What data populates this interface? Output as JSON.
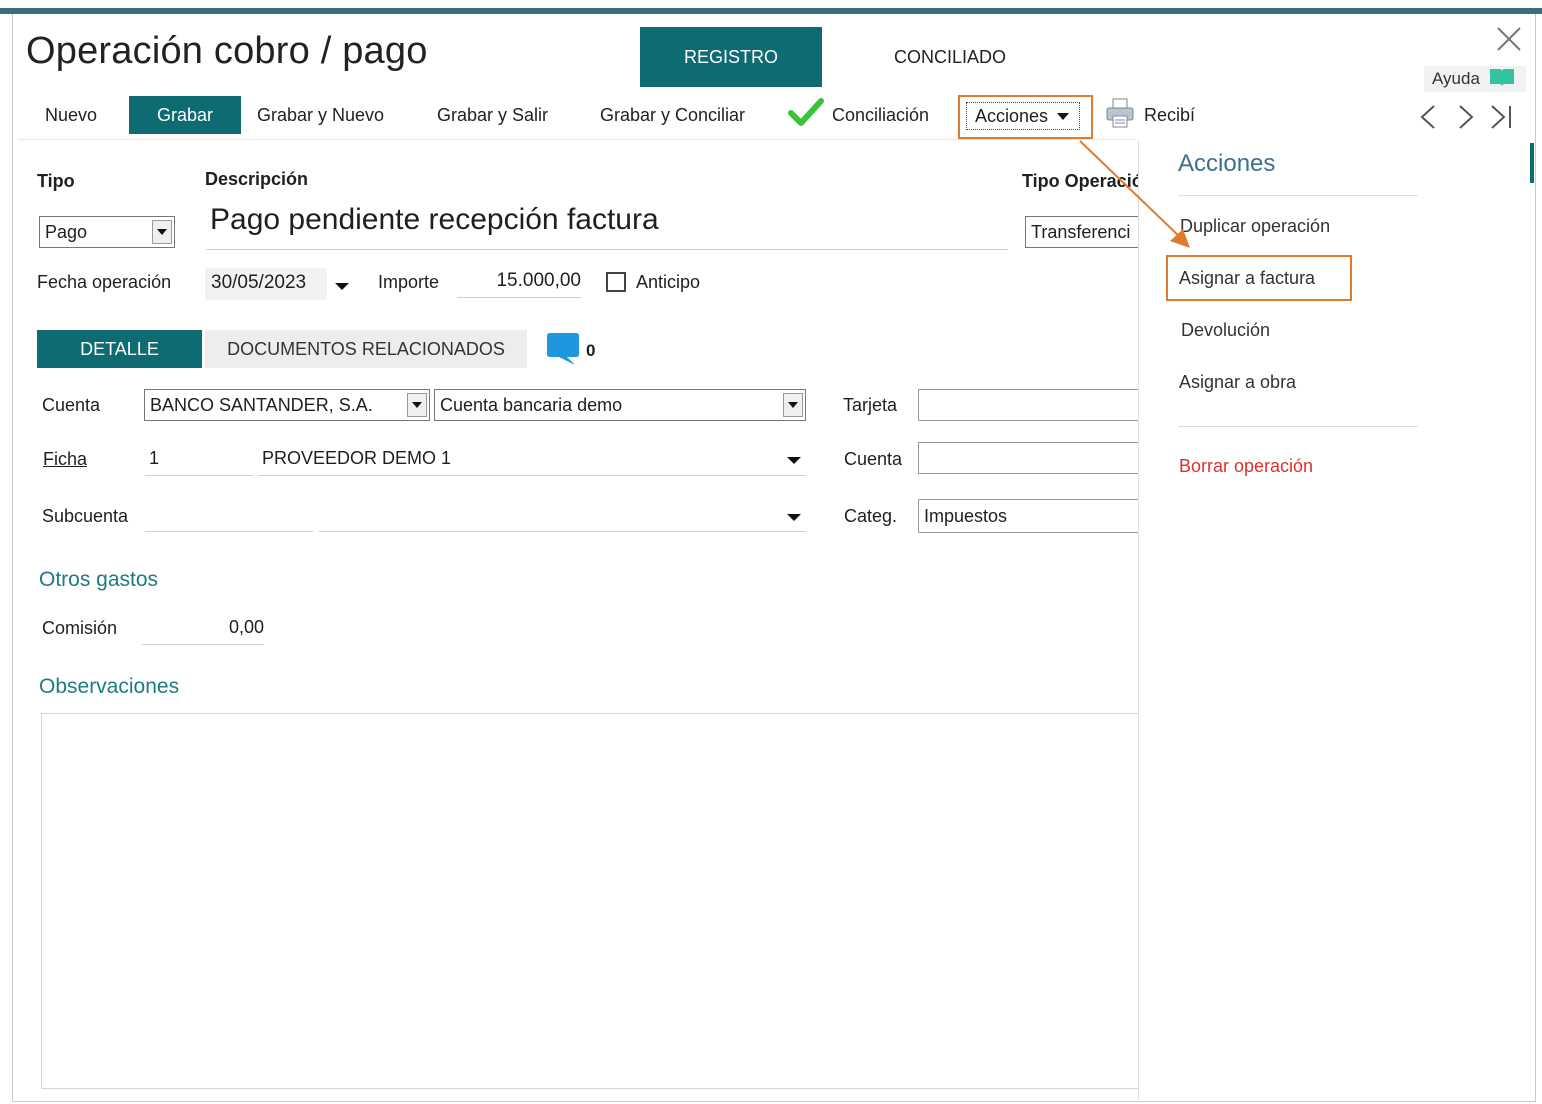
{
  "window": {
    "title": "Operación cobro / pago",
    "tabs": [
      {
        "label": "REGISTRO",
        "active": true
      },
      {
        "label": "CONCILIADO",
        "active": false
      }
    ],
    "help_label": "Ayuda"
  },
  "toolbar": {
    "nuevo": "Nuevo",
    "grabar": "Grabar",
    "grabar_nuevo": "Grabar y Nuevo",
    "grabar_salir": "Grabar y Salir",
    "grabar_conciliar": "Grabar y Conciliar",
    "conciliacion": "Conciliación",
    "acciones": "Acciones",
    "recibi": "Recibí"
  },
  "form": {
    "tipo_label": "Tipo",
    "tipo_value": "Pago",
    "descripcion_label": "Descripción",
    "descripcion_value": "Pago pendiente recepción factura",
    "tipo_operacion_label": "Tipo Operació",
    "tipo_operacion_value": "Transferenci",
    "fecha_label": "Fecha operación",
    "fecha_value": "30/05/2023",
    "importe_label": "Importe",
    "importe_value": "15.000,00",
    "anticipo_label": "Anticipo"
  },
  "detail_tabs": {
    "detalle": "DETALLE",
    "documentos": "DOCUMENTOS RELACIONADOS",
    "comments_count": "0"
  },
  "detail": {
    "cuenta_label": "Cuenta",
    "cuenta_bank": "BANCO SANTANDER, S.A.",
    "cuenta_account": "Cuenta bancaria demo",
    "tarjeta_label": "Tarjeta",
    "ficha_label": "Ficha",
    "ficha_number": "1",
    "ficha_name": "PROVEEDOR DEMO 1",
    "cuenta2_label": "Cuenta",
    "subcuenta_label": "Subcuenta",
    "categ_label": "Categ.",
    "categ_value": "Impuestos",
    "otros_gastos": "Otros gastos",
    "comision_label": "Comisión",
    "comision_value": "0,00",
    "observaciones": "Observaciones"
  },
  "acciones_panel": {
    "title": "Acciones",
    "items": [
      {
        "label": "Duplicar operación"
      },
      {
        "label": "Asignar a factura"
      },
      {
        "label": "Devolución"
      },
      {
        "label": "Asignar a obra"
      }
    ],
    "danger_item": "Borrar operación"
  },
  "colors": {
    "accent": "#0f6b72",
    "highlight": "#e07b2e",
    "danger": "#e0302e",
    "check": "#3cc13b"
  }
}
